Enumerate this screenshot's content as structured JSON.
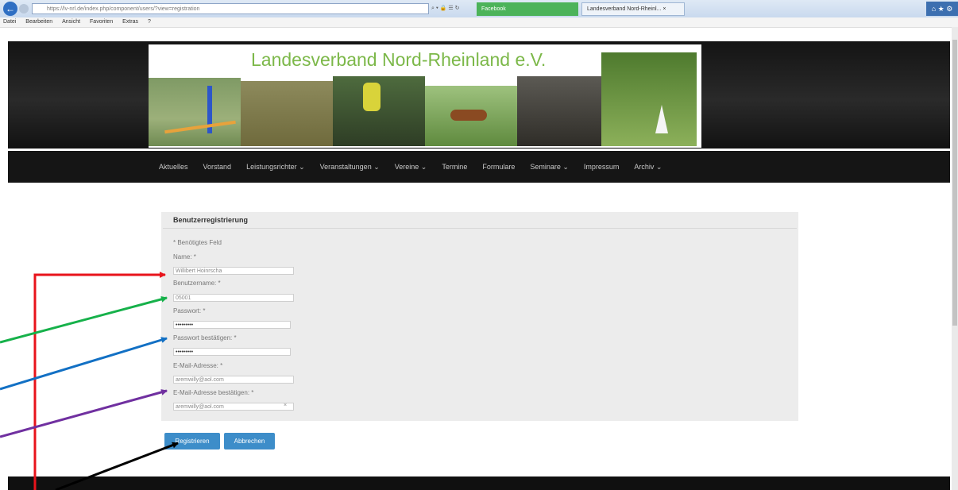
{
  "browser": {
    "address": "https://lv-nrl.de/index.php/component/users/?view=registration",
    "address_tools": "⌕ ▾ 🔒 ☰ ↻",
    "tabs": [
      {
        "label": "Facebook"
      },
      {
        "label": "Landesverband Nord-Rheinl... ×"
      }
    ],
    "window_controls": "⌂ ★ ⚙",
    "menu": [
      "Datei",
      "Bearbeiten",
      "Ansicht",
      "Favoriten",
      "Extras",
      "?"
    ]
  },
  "site": {
    "title": "Landesverband Nord-Rheinland e.V.",
    "nav": [
      "Aktuelles",
      "Vorstand",
      "Leistungsrichter ⌄",
      "Veranstaltungen ⌄",
      "Vereine ⌄",
      "Termine",
      "Formulare",
      "Seminare ⌄",
      "Impressum",
      "Archiv ⌄"
    ]
  },
  "form": {
    "title": "Benutzerregistrierung",
    "required_note": "* Benötigtes Feld",
    "fields": [
      {
        "label": "Name: *",
        "value": "Willibert Hoinrscha"
      },
      {
        "label": "Benutzername: *",
        "value": "05001"
      },
      {
        "label": "Passwort: *",
        "value": "•••••••••"
      },
      {
        "label": "Passwort bestätigen: *",
        "value": "•••••••••"
      },
      {
        "label": "E-Mail-Adresse: *",
        "value": "aremwilly@aol.com"
      },
      {
        "label": "E-Mail-Adresse bestätigen: *",
        "value": "aremwilly@aol.com"
      }
    ],
    "register_button": "Registrieren",
    "cancel_button": "Abbrechen"
  },
  "annotation_colors": {
    "red": "#e8131b",
    "green": "#16b14a",
    "blue": "#1270c4",
    "purple": "#7030a0",
    "black": "#000000"
  }
}
